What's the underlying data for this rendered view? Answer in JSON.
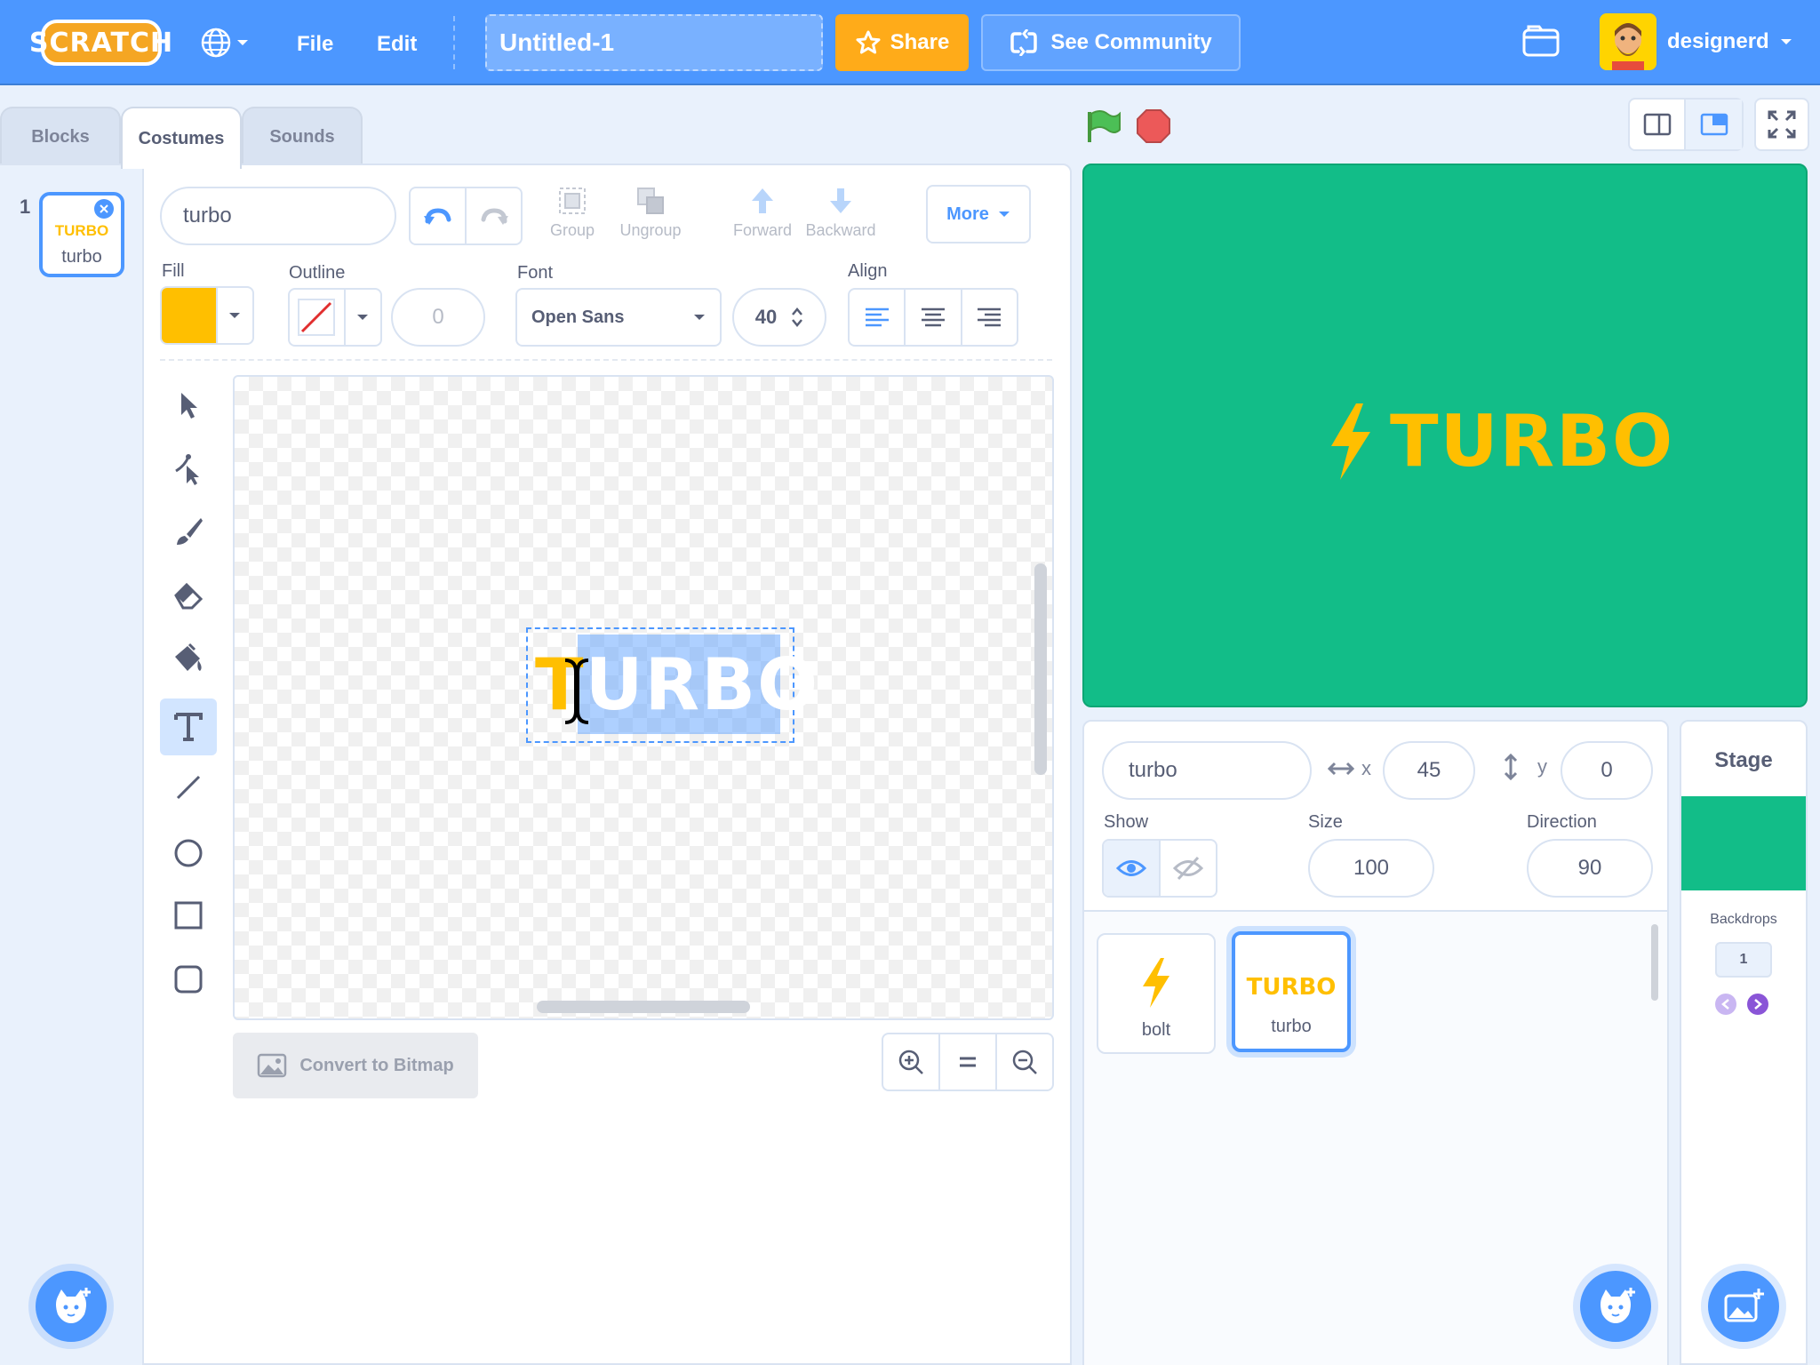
{
  "menubar": {
    "logo": "SCRATCH",
    "file": "File",
    "edit": "Edit",
    "project_title": "Untitled-1",
    "share": "Share",
    "see_community": "See Community",
    "username": "designerd"
  },
  "tabs": [
    {
      "label": "Blocks"
    },
    {
      "label": "Costumes"
    },
    {
      "label": "Sounds"
    }
  ],
  "costume_list": [
    {
      "index": "1",
      "thumb_text": "TURBO",
      "name": "turbo"
    }
  ],
  "paint": {
    "costume_name": "turbo",
    "group": "Group",
    "ungroup": "Ungroup",
    "forward": "Forward",
    "backward": "Backward",
    "more": "More",
    "fill_label": "Fill",
    "fill_color": "#ffbf00",
    "outline_label": "Outline",
    "outline_width": "0",
    "font_label": "Font",
    "font_value": "Open Sans",
    "font_size": "40",
    "align_label": "Align",
    "canvas_text_first": "T",
    "canvas_text_rest": "URBO",
    "convert": "Convert to Bitmap"
  },
  "stage": {
    "bg_color": "#12bd88",
    "text": "TURBO"
  },
  "sprite_info": {
    "name": "turbo",
    "x_label": "x",
    "x_value": "45",
    "y_label": "y",
    "y_value": "0",
    "show_label": "Show",
    "size_label": "Size",
    "size_value": "100",
    "direction_label": "Direction",
    "direction_value": "90"
  },
  "sprites": [
    {
      "name": "bolt",
      "selected": false
    },
    {
      "name": "turbo",
      "thumb_text": "TURBO",
      "selected": true
    }
  ],
  "stage_pane": {
    "title": "Stage",
    "backdrops_label": "Backdrops",
    "backdrops_count": "1"
  }
}
